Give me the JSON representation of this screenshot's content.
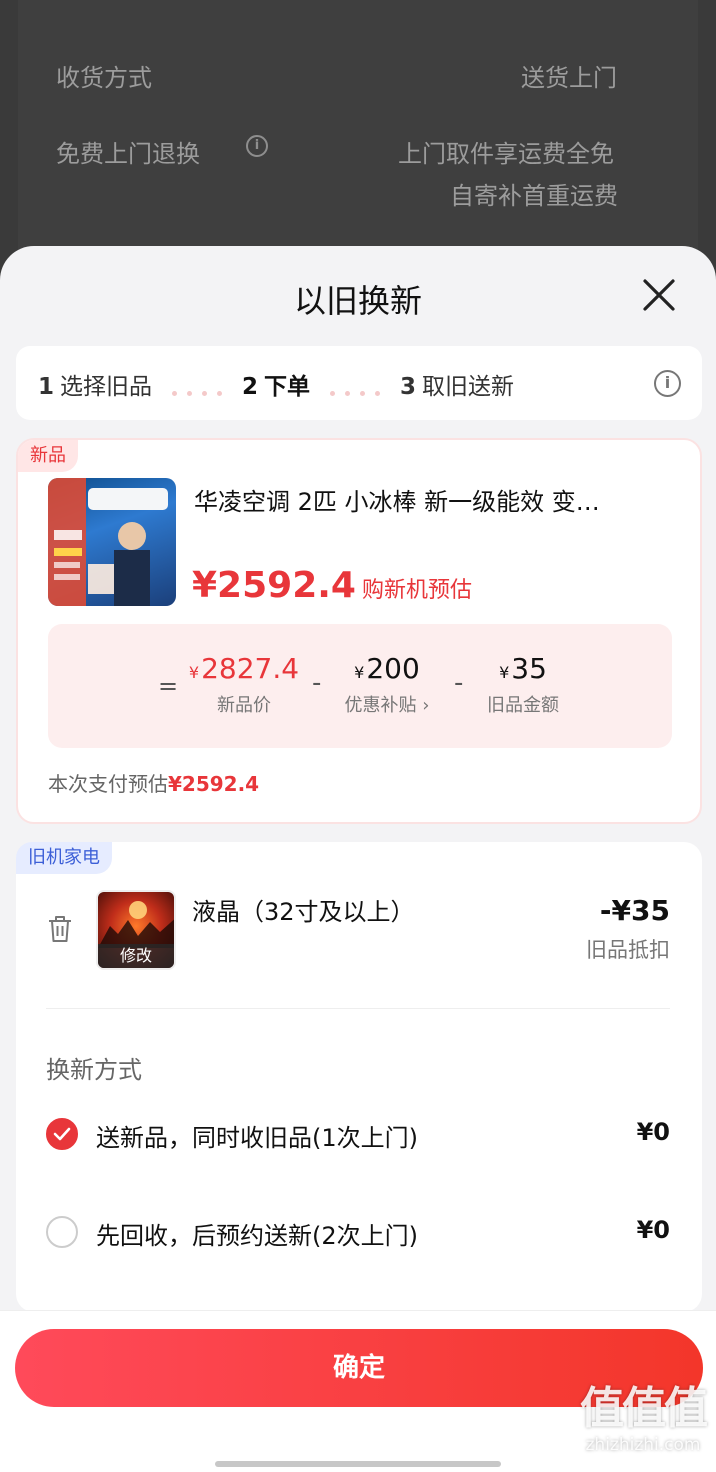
{
  "background": {
    "rows": [
      {
        "label": "收货方式",
        "value": "送货上门"
      },
      {
        "label": "免费上门退换",
        "value_line1": "上门取件享运费全免",
        "value_line2": "自寄补首重运费"
      }
    ]
  },
  "sheet": {
    "title": "以旧换新",
    "steps": [
      {
        "num": "1",
        "label": "选择旧品"
      },
      {
        "num": "2",
        "label": "下单"
      },
      {
        "num": "3",
        "label": "取旧送新"
      }
    ]
  },
  "new_item": {
    "tag": "新品",
    "title": "华凌空调 2匹 小冰棒 新一级能效 变…",
    "price": "¥2592.4",
    "price_label": "购新机预估",
    "calc": {
      "new_price_symbol": "¥",
      "new_price_value": "2827.4",
      "new_price_label": "新品价",
      "subsidy_symbol": "¥",
      "subsidy_value": "200",
      "subsidy_label": "优惠补贴 ›",
      "trade_symbol": "¥",
      "trade_value": "35",
      "trade_label": "旧品金额"
    },
    "pay_label": "本次支付预估",
    "pay_value": "¥2592.4"
  },
  "old_item": {
    "tag": "旧机家电",
    "title": "液晶（32寸及以上）",
    "edit_label": "修改",
    "amount": "-¥35",
    "amount_note": "旧品抵扣",
    "method_title": "换新方式",
    "options": [
      {
        "label": "送新品，同时收旧品(1次上门)",
        "price": "¥0",
        "checked": true
      },
      {
        "label": "先回收，后预约送新(2次上门)",
        "price": "¥0",
        "checked": false
      }
    ]
  },
  "footer": {
    "confirm_label": "确定"
  },
  "watermark": {
    "logo": "值值值",
    "url": "zhizhizhi.com"
  },
  "colors": {
    "accent": "#e8363a",
    "tag_new_bg": "#ffe6e6",
    "tag_old_bg": "#e6ecff"
  }
}
